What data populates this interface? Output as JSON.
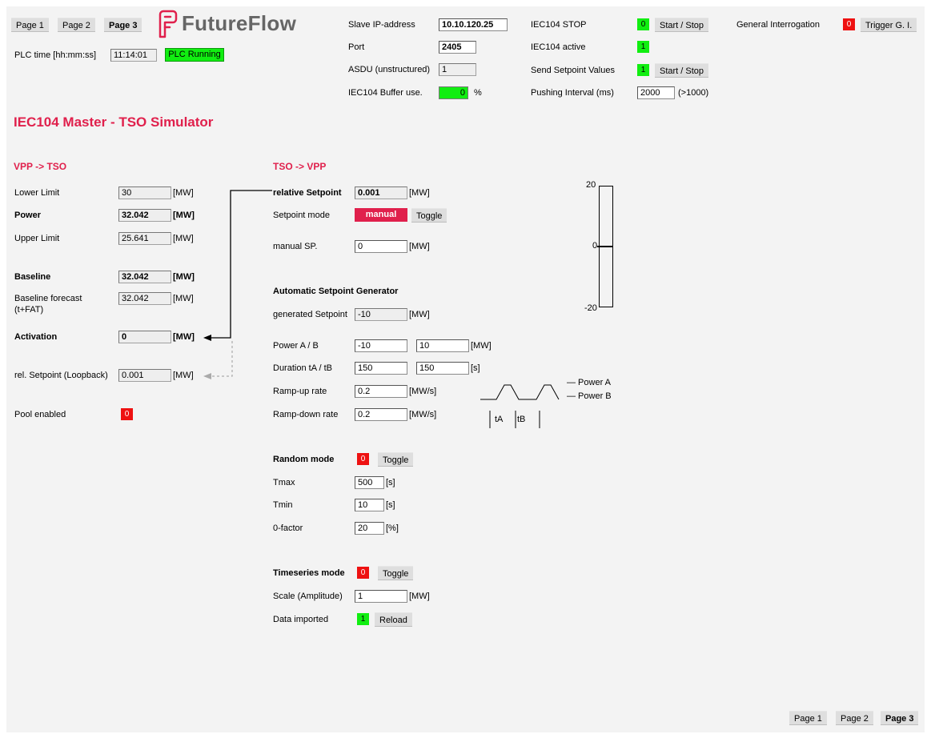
{
  "colors": {
    "accent": "#e0204c",
    "led_on": "#11ee11",
    "led_off": "#ee1111",
    "panel_bg": "#f3f3f3"
  },
  "nav": {
    "page1": "Page 1",
    "page2": "Page 2",
    "page3": "Page 3"
  },
  "brand": {
    "name": "FutureFlow"
  },
  "plc": {
    "time_label": "PLC time [hh:mm:ss]",
    "time_value": "11:14:01",
    "status": "PLC Running"
  },
  "conn": {
    "slave_ip_label": "Slave IP-address",
    "slave_ip": "10.10.120.25",
    "port_label": "Port",
    "port": "2405",
    "asdu_label": "ASDU (unstructured)",
    "asdu": "1",
    "buffer_label": "IEC104 Buffer use.",
    "buffer_value": "0",
    "buffer_unit": "%"
  },
  "iec": {
    "stop_label": "IEC104 STOP",
    "stop_led": "0",
    "start_stop": "Start / Stop",
    "active_label": "IEC104 active",
    "active_led": "1",
    "send_label": "Send Setpoint Values",
    "send_led": "1",
    "send_btn": "Start / Stop",
    "push_label": "Pushing Interval (ms)",
    "push_value": "2000",
    "push_hint": "(>1000)"
  },
  "gi": {
    "label": "General Interrogation",
    "led": "0",
    "button": "Trigger G. I."
  },
  "page_title": "IEC104 Master - TSO Simulator",
  "vpp": {
    "title": "VPP -> TSO",
    "lower_label": "Lower Limit",
    "lower": "30",
    "lower_unit": "[MW]",
    "power_label": "Power",
    "power": "32.042",
    "power_unit": "[MW]",
    "upper_label": "Upper Limit",
    "upper": "25.641",
    "upper_unit": "[MW]",
    "baseline_label": "Baseline",
    "baseline": "32.042",
    "baseline_unit": "[MW]",
    "forecast_label1": "Baseline forecast",
    "forecast_label2": "(t+FAT)",
    "forecast": "32.042",
    "forecast_unit": "[MW]",
    "activation_label": "Activation",
    "activation": "0",
    "activation_unit": "[MW]",
    "loopback_label": "rel. Setpoint (Loopback)",
    "loopback": "0.001",
    "loopback_unit": "[MW]",
    "pool_label": "Pool enabled",
    "pool_led": "0"
  },
  "tso": {
    "title": "TSO -> VPP",
    "rel_label": "relative Setpoint",
    "rel": "0.001",
    "rel_unit": "[MW]",
    "mode_label": "Setpoint mode",
    "mode": "manual",
    "toggle": "Toggle",
    "manual_label": "manual SP.",
    "manual": "0",
    "manual_unit": "[MW]",
    "gen_title": "Automatic Setpoint Generator",
    "gen_label": "generated Setpoint",
    "gen": "-10",
    "gen_unit": "[MW]",
    "power_ab_label": "Power A / B",
    "power_a": "-10",
    "power_b": "10",
    "power_unit": "[MW]",
    "dur_label": "Duration tA / tB",
    "dur_a": "150",
    "dur_b": "150",
    "dur_unit": "[s]",
    "rampup_label": "Ramp-up rate",
    "rampup": "0.2",
    "rampup_unit": "[MW/s]",
    "rampdown_label": "Ramp-down rate",
    "rampdown": "0.2",
    "rampdown_unit": "[MW/s]",
    "legend_a": "— Power A",
    "legend_b": "— Power B",
    "ta": "tA",
    "tb": "tB"
  },
  "random": {
    "label": "Random mode",
    "led": "0",
    "toggle": "Toggle",
    "tmax_label": "Tmax",
    "tmax": "500",
    "tmax_unit": "[s]",
    "tmin_label": "Tmin",
    "tmin": "10",
    "tmin_unit": "[s]",
    "zf_label": "0-factor",
    "zf": "20",
    "zf_unit": "[%]"
  },
  "timeseries": {
    "label": "Timeseries mode",
    "led": "0",
    "toggle": "Toggle",
    "scale_label": "Scale (Amplitude)",
    "scale": "1",
    "scale_unit": "[MW]",
    "imported_label": "Data imported",
    "imported_led": "1",
    "reload": "Reload"
  },
  "gauge": {
    "max_label": "20",
    "mid_label": "0",
    "min_label": "-20",
    "max": 20,
    "min": -20,
    "value": 0.001
  }
}
